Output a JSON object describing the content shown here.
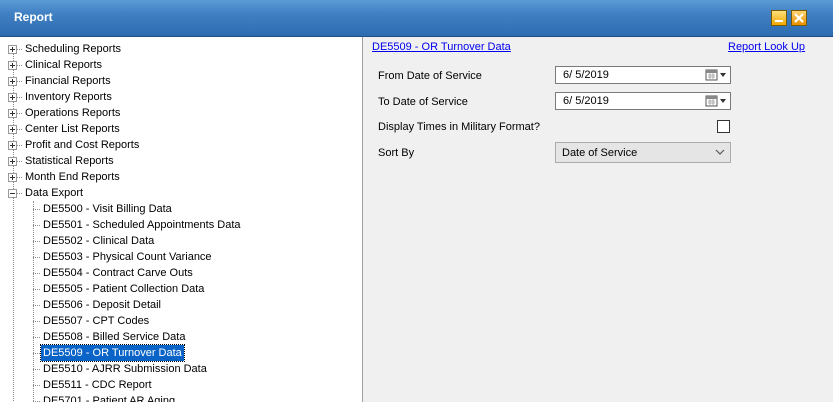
{
  "window": {
    "title": "Report"
  },
  "tree": {
    "groups": [
      {
        "label": "Scheduling Reports",
        "expanded": false
      },
      {
        "label": "Clinical Reports",
        "expanded": false
      },
      {
        "label": "Financial Reports",
        "expanded": false
      },
      {
        "label": "Inventory Reports",
        "expanded": false
      },
      {
        "label": "Operations Reports",
        "expanded": false
      },
      {
        "label": "Center List Reports",
        "expanded": false
      },
      {
        "label": "Profit and Cost Reports",
        "expanded": false
      },
      {
        "label": "Statistical Reports",
        "expanded": false
      },
      {
        "label": "Month End Reports",
        "expanded": false
      },
      {
        "label": "Data Export",
        "expanded": true
      }
    ],
    "children": [
      "DE5500 - Visit Billing Data",
      "DE5501 - Scheduled Appointments Data",
      "DE5502 - Clinical Data",
      "DE5503 - Physical Count Variance",
      "DE5504 - Contract Carve Outs",
      "DE5505 - Patient Collection Data",
      "DE5506 - Deposit Detail",
      "DE5507 - CPT Codes",
      "DE5508 - Billed Service Data",
      "DE5509 - OR Turnover Data",
      "DE5510 - AJRR Submission Data",
      "DE5511 - CDC Report",
      "DE5701 - Patient AR Aging"
    ],
    "selected_child": "DE5509 - OR Turnover Data"
  },
  "report": {
    "title_link": "DE5509 - OR Turnover Data",
    "lookup_link": "Report Look Up",
    "from_label": "From Date of Service",
    "from_value": "6/  5/2019",
    "to_label": "To Date of Service",
    "to_value": "6/  5/2019",
    "military_label": "Display Times in Military Format?",
    "military_checked": false,
    "sort_label": "Sort By",
    "sort_value": "Date of Service"
  },
  "icons": {
    "minimize": "minimize-icon",
    "close": "close-icon",
    "calendar": "calendar-icon",
    "dropdown": "chevron-down-icon",
    "expand": "plus-icon",
    "collapse": "minus-icon"
  }
}
